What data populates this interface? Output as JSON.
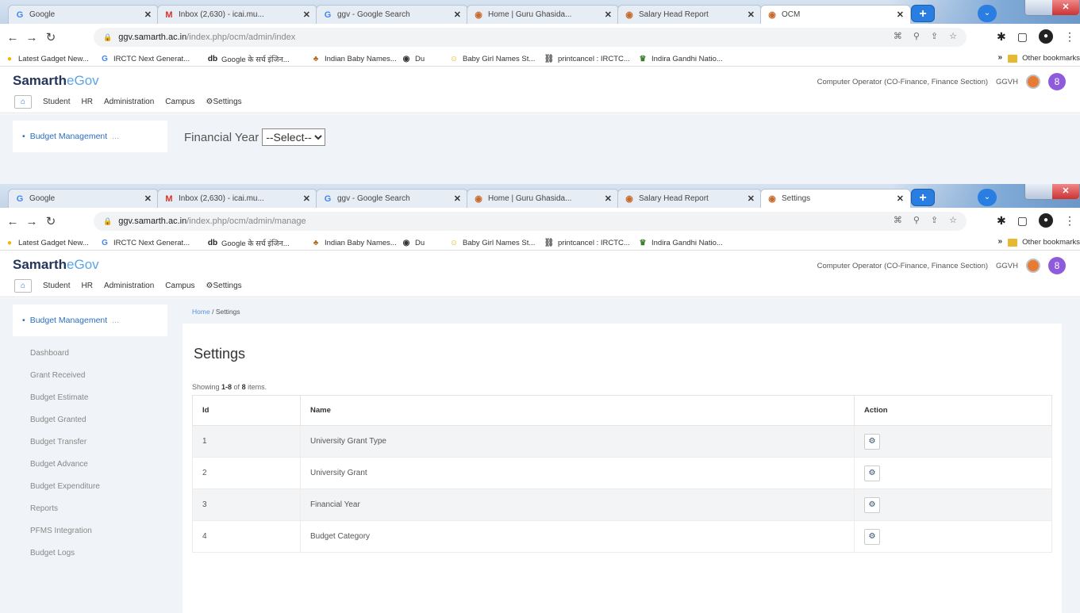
{
  "tab_icons": {
    "google": "google-icon",
    "gmail": "gmail-icon",
    "samarth": "samarth-favicon"
  },
  "window1": {
    "tabs": [
      {
        "title": "Google",
        "icon": "G",
        "color": "#4285f4"
      },
      {
        "title": "Inbox (2,630) - icai.mu...",
        "icon": "M",
        "color": "#d93025"
      },
      {
        "title": "ggv - Google Search",
        "icon": "G",
        "color": "#4285f4"
      },
      {
        "title": "Home | Guru Ghasida...",
        "icon": "◉",
        "color": "#c96a2b"
      },
      {
        "title": "Salary Head Report",
        "icon": "◉",
        "color": "#c96a2b"
      },
      {
        "title": "OCM",
        "icon": "◉",
        "color": "#c96a2b"
      }
    ],
    "url_host": "ggv.samarth.ac.in",
    "url_path": "/index.php/ocm/admin/index",
    "financial_year_label": "Financial Year",
    "financial_year_select": "--Select--"
  },
  "window2": {
    "tabs": [
      {
        "title": "Google",
        "icon": "G",
        "color": "#4285f4"
      },
      {
        "title": "Inbox (2,630) - icai.mu...",
        "icon": "M",
        "color": "#d93025"
      },
      {
        "title": "ggv - Google Search",
        "icon": "G",
        "color": "#4285f4"
      },
      {
        "title": "Home | Guru Ghasida...",
        "icon": "◉",
        "color": "#c96a2b"
      },
      {
        "title": "Salary Head Report",
        "icon": "◉",
        "color": "#c96a2b"
      },
      {
        "title": "Settings",
        "icon": "◉",
        "color": "#c96a2b"
      }
    ],
    "url_host": "ggv.samarth.ac.in",
    "url_path": "/index.php/ocm/admin/manage",
    "breadcrumb": {
      "home": "Home",
      "sep": "/",
      "current": "Settings"
    },
    "page_title": "Settings",
    "summary": {
      "prefix": "Showing ",
      "range": "1-8",
      "mid": " of ",
      "total": "8",
      "suffix": " items."
    },
    "table": {
      "headers": {
        "id": "Id",
        "name": "Name",
        "action": "Action"
      },
      "rows": [
        {
          "id": "1",
          "name": "University Grant Type"
        },
        {
          "id": "2",
          "name": "University Grant"
        },
        {
          "id": "3",
          "name": "Financial Year"
        },
        {
          "id": "4",
          "name": "Budget Category"
        }
      ]
    },
    "sidebar_items": [
      "Dashboard",
      "Grant Received",
      "Budget Estimate",
      "Budget Granted",
      "Budget Transfer",
      "Budget Advance",
      "Budget Expenditure",
      "Reports",
      "PFMS Integration",
      "Budget Logs"
    ]
  },
  "bookmarks": [
    {
      "label": "Latest Gadget New...",
      "icon": "●",
      "color": "#f4b400"
    },
    {
      "label": "IRCTC Next Generat...",
      "icon": "G",
      "color": "#4285f4"
    },
    {
      "label": "Google के सर्च इंजिन...",
      "icon": "db",
      "color": "#222"
    },
    {
      "label": "Indian Baby Names...",
      "icon": "♣",
      "color": "#b36b1d"
    },
    {
      "label": "Du",
      "icon": "◉",
      "color": "#333"
    },
    {
      "label": "Baby Girl Names St...",
      "icon": "☺",
      "color": "#e8b400"
    },
    {
      "label": "printcancel : IRCTC...",
      "icon": "⛓",
      "color": "#666"
    },
    {
      "label": "Indira Gandhi Natio...",
      "icon": "♛",
      "color": "#3a7d2a"
    }
  ],
  "bookmarks_more": "»",
  "other_bookmarks": "Other bookmarks",
  "app": {
    "logo_main": "Samarth",
    "logo_sub": "eGov",
    "user_role": "Computer Operator (CO-Finance, Finance Section)",
    "org": "GGVH",
    "avatar_letter": "8",
    "menu": [
      "Student",
      "HR",
      "Administration",
      "Campus"
    ],
    "menu_settings": "Settings",
    "sidebar_module": "Budget Management",
    "sidebar_module_suffix": "..."
  }
}
